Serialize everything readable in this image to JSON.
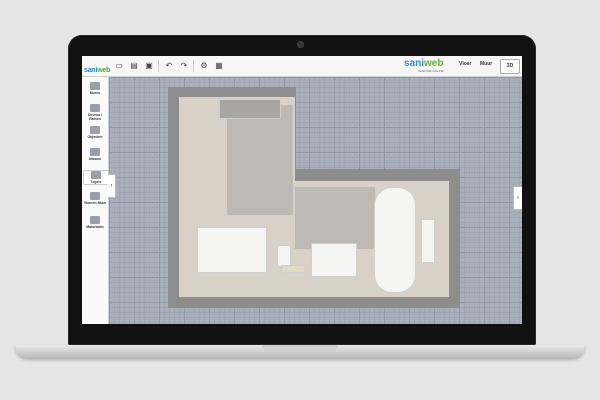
{
  "app": {
    "logo_left": {
      "part1": "sani",
      "part2": "web"
    },
    "brand": {
      "part1": "sani",
      "part2": "web",
      "tagline": "SANITAIR ONLINE"
    }
  },
  "toolbar": {
    "views": [
      "Vloer",
      "Muur"
    ],
    "mode_label": "3D"
  },
  "sidebar": {
    "items": [
      {
        "label": "Muren",
        "icon": "walls-icon"
      },
      {
        "label": "Deuren / Ramen",
        "icon": "door-icon"
      },
      {
        "label": "Objecten",
        "icon": "object-icon"
      },
      {
        "label": "Inbouw",
        "icon": "builtin-icon"
      },
      {
        "label": "Tegels",
        "icon": "tiles-icon"
      },
      {
        "label": "Vloeren Muur",
        "icon": "floor-icon"
      },
      {
        "label": "Materialen",
        "icon": "materials-icon"
      }
    ]
  },
  "colors": {
    "accent_blue": "#2c8fd6",
    "accent_green": "#5fb03a",
    "grid": "#a9b0bb"
  }
}
